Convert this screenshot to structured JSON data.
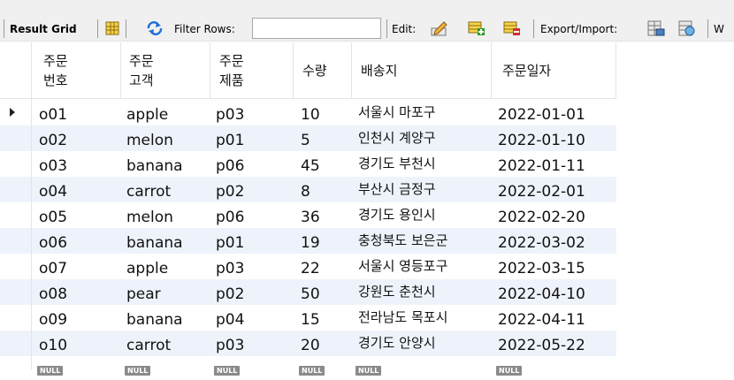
{
  "toolbar": {
    "result_grid": "Result Grid",
    "filter_rows": "Filter Rows:",
    "filter_value": "",
    "edit": "Edit:",
    "export_import": "Export/Import:",
    "wrap_cut": "W"
  },
  "columns": [
    "주문\n번호",
    "주문\n고객",
    "주문\n제품",
    "수량",
    "배송지",
    "주문일자"
  ],
  "rows": [
    [
      "o01",
      "apple",
      "p03",
      "10",
      "서울시 마포구",
      "2022-01-01"
    ],
    [
      "o02",
      "melon",
      "p01",
      "5",
      "인천시 계양구",
      "2022-01-10"
    ],
    [
      "o03",
      "banana",
      "p06",
      "45",
      "경기도 부천시",
      "2022-01-11"
    ],
    [
      "o04",
      "carrot",
      "p02",
      "8",
      "부산시 금정구",
      "2022-02-01"
    ],
    [
      "o05",
      "melon",
      "p06",
      "36",
      "경기도 용인시",
      "2022-02-20"
    ],
    [
      "o06",
      "banana",
      "p01",
      "19",
      "충청북도 보은군",
      "2022-03-02"
    ],
    [
      "o07",
      "apple",
      "p03",
      "22",
      "서울시 영등포구",
      "2022-03-15"
    ],
    [
      "o08",
      "pear",
      "p02",
      "50",
      "강원도 춘천시",
      "2022-04-10"
    ],
    [
      "o09",
      "banana",
      "p04",
      "15",
      "전라남도 목포시",
      "2022-04-11"
    ],
    [
      "o10",
      "carrot",
      "p03",
      "20",
      "경기도 안양시",
      "2022-05-22"
    ]
  ],
  "null_label": "NULL",
  "new_row_marker": "*",
  "colors": {
    "alt_row": "#eef3fb",
    "accent": "#1e6fd9"
  }
}
